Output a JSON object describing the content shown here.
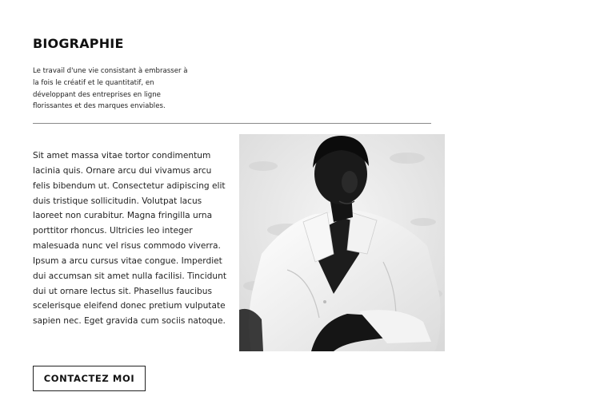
{
  "section": {
    "title": "BIOGRAPHIE",
    "intro": "Le travail d'une vie consistant à embrasser à la fois le créatif et le quantitatif, en développant des entreprises en ligne florissantes et des marques enviables.",
    "body": "Sit amet massa vitae tortor condimentum lacinia quis. Ornare arcu dui vivamus arcu felis bibendum ut. Consectetur adipiscing elit duis tristique sollicitudin. Volutpat lacus laoreet non curabitur. Magna fringilla urna porttitor rhoncus. Ultricies leo integer malesuada nunc vel risus commodo viverra. Ipsum a arcu cursus vitae congue. Imperdiet dui accumsan sit amet nulla facilisi. Tincidunt dui ut ornare lectus sit. Phasellus faucibus scelerisque eleifend donec pretium vulputate sapien nec. Eget gravida cum sociis natoque.",
    "cta_label": "CONTACTEZ MOI"
  }
}
